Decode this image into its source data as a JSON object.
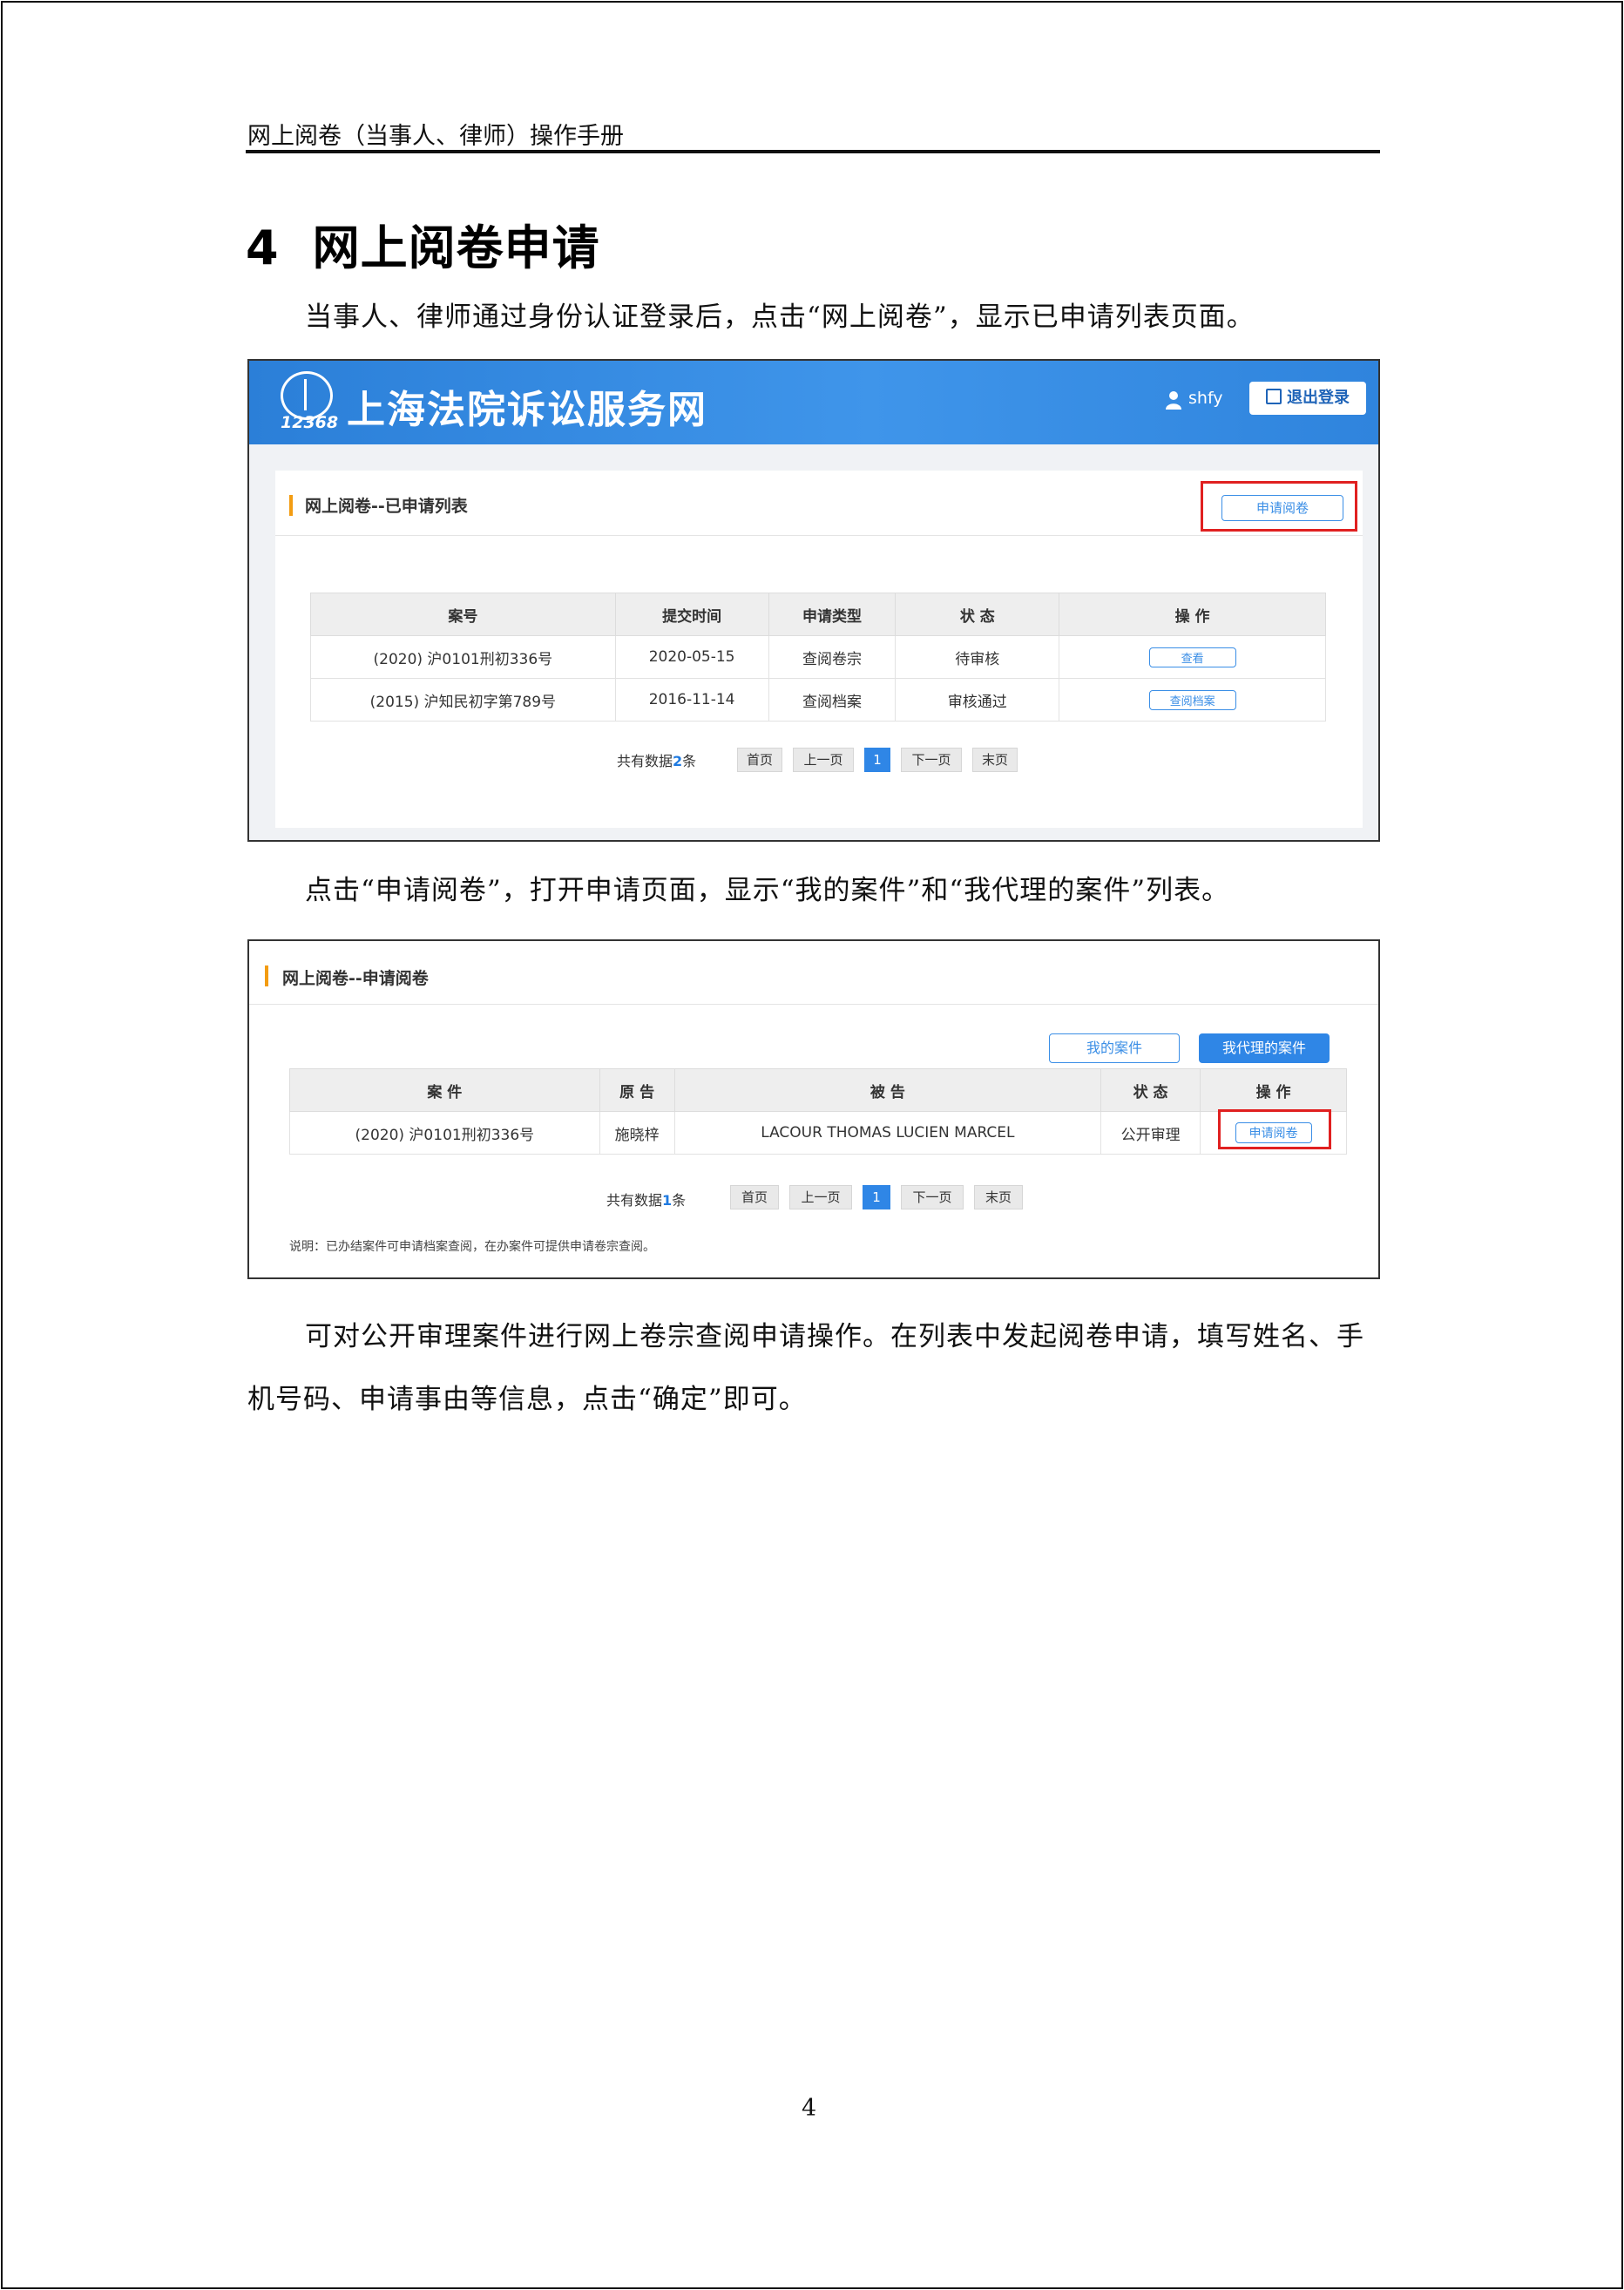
{
  "header": {
    "running_title": "网上阅卷（当事人、律师）操作手册"
  },
  "section": {
    "number": "4",
    "title": "网上阅卷申请"
  },
  "paragraphs": {
    "p1": "当事人、律师通过身份认证登录后，点击“网上阅卷”，显示已申请列表页面。",
    "p2": "点击“申请阅卷”，打开申请页面，显示“我的案件”和“我代理的案件”列表。",
    "p3_line1": "可对公开审理案件进行网上卷宗查阅申请操作。在列表中发起阅卷申请，填写姓名、手",
    "p3_line2": "机号码、申请事由等信息，点击“确定”即可。"
  },
  "screenshot1": {
    "logo_number": "12368",
    "site_title": "上海法院诉讼服务网",
    "username": "shfy",
    "logout_label": "退出登录",
    "panel_title": "网上阅卷--已申请列表",
    "apply_button": "申请阅卷",
    "columns": [
      "案号",
      "提交时间",
      "申请类型",
      "状 态",
      "操 作"
    ],
    "rows": [
      {
        "case_no": "(2020) 沪0101刑初336号",
        "time": "2020-05-15",
        "type": "查阅卷宗",
        "status": "待审核",
        "action": "查看"
      },
      {
        "case_no": "(2015) 沪知民初字第789号",
        "time": "2016-11-14",
        "type": "查阅档案",
        "status": "审核通过",
        "action": "查阅档案"
      }
    ],
    "pager": {
      "prefix": "共有数据",
      "count": "2",
      "suffix": "条",
      "first": "首页",
      "prev": "上一页",
      "current": "1",
      "next": "下一页",
      "last": "末页"
    }
  },
  "screenshot2": {
    "panel_title": "网上阅卷--申请阅卷",
    "tab_mine": "我的案件",
    "tab_agent": "我代理的案件",
    "columns": [
      "案 件",
      "原 告",
      "被 告",
      "状 态",
      "操 作"
    ],
    "rows": [
      {
        "case": "(2020) 沪0101刑初336号",
        "plaintiff": "施晓梓",
        "defendant": "LACOUR THOMAS LUCIEN MARCEL",
        "status": "公开审理",
        "action": "申请阅卷"
      }
    ],
    "pager": {
      "prefix": "共有数据",
      "count": "1",
      "suffix": "条",
      "first": "首页",
      "prev": "上一页",
      "current": "1",
      "next": "下一页",
      "last": "末页"
    },
    "note": "说明：已办结案件可申请档案查阅，在办案件可提供申请卷宗查阅。"
  },
  "footer": {
    "page_number": "4"
  },
  "colors": {
    "accent": "#2f86e6",
    "highlight": "#e02020",
    "pending": "#d42323",
    "approved": "#2e9a3a"
  }
}
